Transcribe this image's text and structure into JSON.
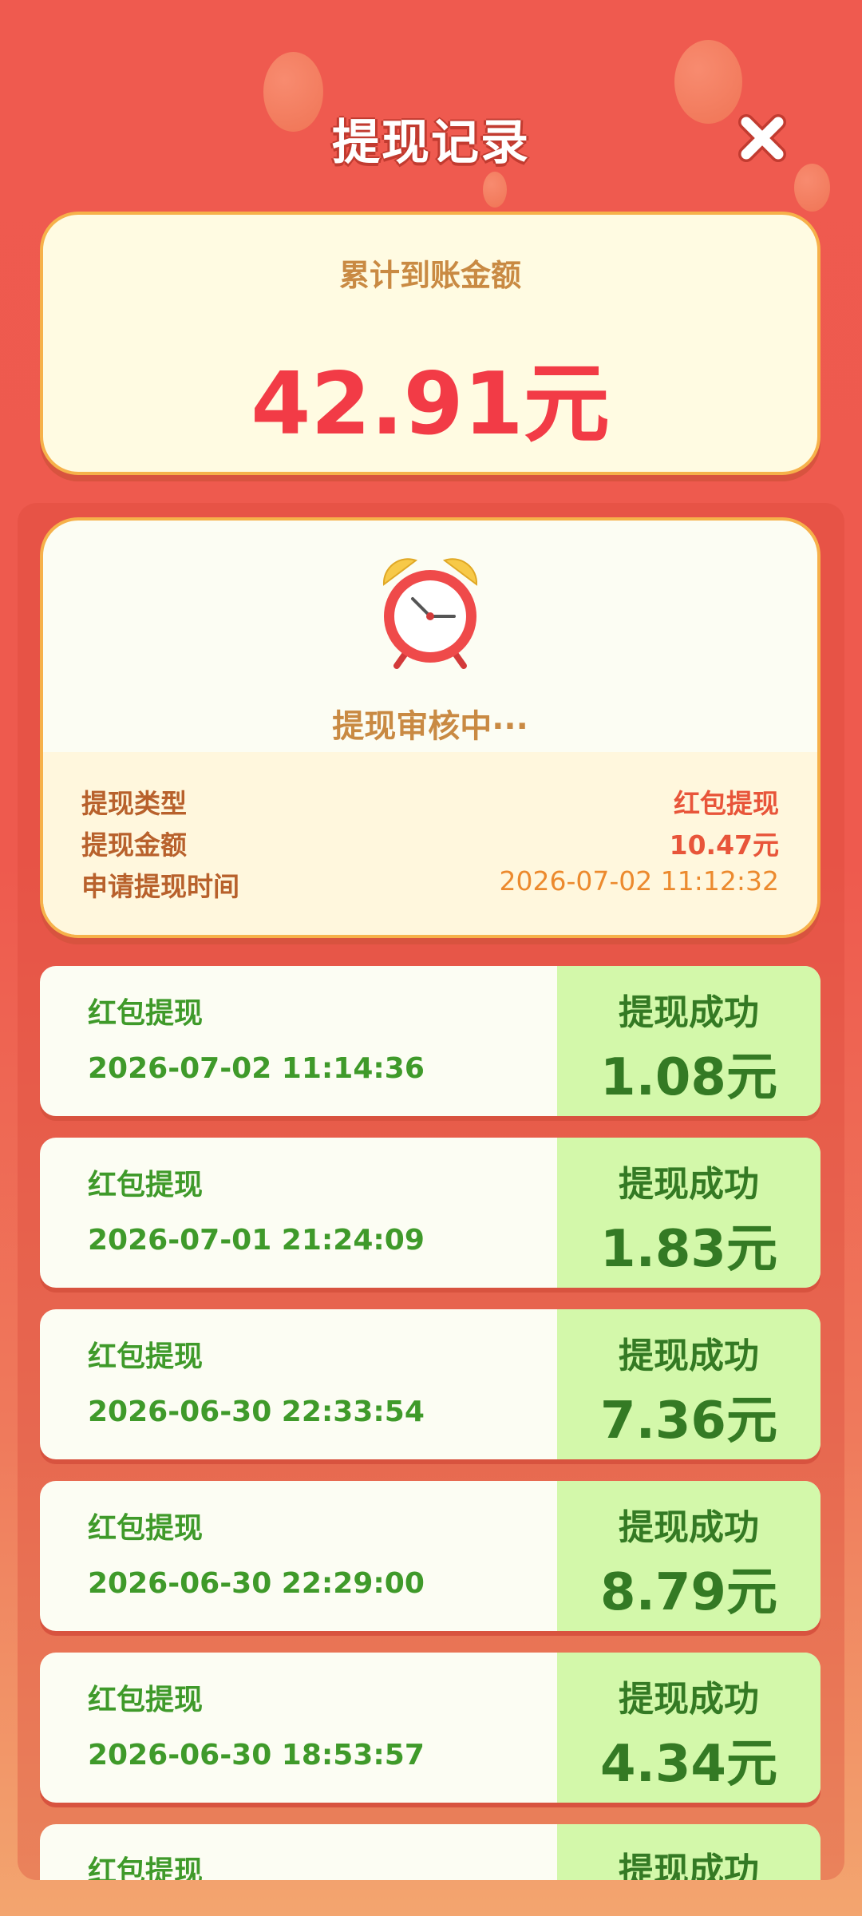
{
  "header": {
    "title": "提现记录",
    "close_icon": "close-icon"
  },
  "summary": {
    "label": "累计到账金额",
    "amount": "42.91元"
  },
  "pending": {
    "icon": "alarm-clock-icon",
    "status": "提现审核中···",
    "rows": [
      {
        "label": "提现类型",
        "value": "红包提现",
        "value_color": "#e8553a"
      },
      {
        "label": "提现金额",
        "value": "10.47元",
        "value_color": "#e8553a"
      },
      {
        "label": "申请提现时间",
        "value": "2026-07-02 11:12:32",
        "value_color": "#ec8a2e"
      }
    ]
  },
  "records": [
    {
      "type": "红包提现",
      "time": "2026-07-02 11:14:36",
      "status": "提现成功",
      "amount": "1.08元"
    },
    {
      "type": "红包提现",
      "time": "2026-07-01 21:24:09",
      "status": "提现成功",
      "amount": "1.83元"
    },
    {
      "type": "红包提现",
      "time": "2026-06-30 22:33:54",
      "status": "提现成功",
      "amount": "7.36元"
    },
    {
      "type": "红包提现",
      "time": "2026-06-30 22:29:00",
      "status": "提现成功",
      "amount": "8.79元"
    },
    {
      "type": "红包提现",
      "time": "2026-06-30 18:53:57",
      "status": "提现成功",
      "amount": "4.34元"
    },
    {
      "type": "红包提现",
      "time": "",
      "status": "提现成功",
      "amount": ""
    }
  ],
  "colors": {
    "accent_red": "#f23b46",
    "success_green": "#347a24",
    "success_bg": "#d3f8aa",
    "gold_border": "#f6b14a"
  }
}
